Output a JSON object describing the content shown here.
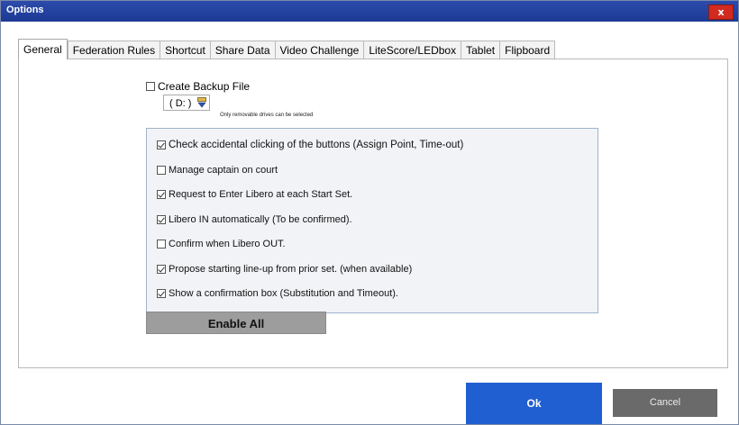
{
  "window": {
    "title": "Options",
    "close_label": "x"
  },
  "tabs": [
    {
      "label": "General",
      "active": true
    },
    {
      "label": "Federation Rules",
      "active": false
    },
    {
      "label": "Shortcut",
      "active": false
    },
    {
      "label": "Share Data",
      "active": false
    },
    {
      "label": "Video Challenge",
      "active": false
    },
    {
      "label": "LiteScore/LEDbox",
      "active": false
    },
    {
      "label": "Tablet",
      "active": false
    },
    {
      "label": "Flipboard",
      "active": false
    }
  ],
  "backup": {
    "label": "Create Backup File",
    "checked": false,
    "drive_value": "( D: )",
    "drive_note": "Only removable drives can be selected"
  },
  "options": [
    {
      "label": "Check accidental clicking of the buttons (Assign Point, Time-out)",
      "checked": true
    },
    {
      "label": "Manage captain on court",
      "checked": false
    },
    {
      "label": "Request to Enter Libero at each Start Set.",
      "checked": true
    },
    {
      "label": "Libero IN automatically (To be confirmed).",
      "checked": true
    },
    {
      "label": "Confirm when Libero OUT.",
      "checked": false
    },
    {
      "label": "Propose starting line-up from prior set. (when available)",
      "checked": true
    },
    {
      "label": "Show a confirmation box (Substitution and Timeout).",
      "checked": true
    }
  ],
  "buttons": {
    "enable_all": "Enable All",
    "ok": "Ok",
    "cancel": "Cancel"
  },
  "colors": {
    "titlebar": "#1d3a93",
    "ok_button": "#1f5fd1",
    "cancel_button": "#6a6a6a",
    "close_button": "#d22a1f",
    "options_panel_border": "#9fb3cc"
  }
}
